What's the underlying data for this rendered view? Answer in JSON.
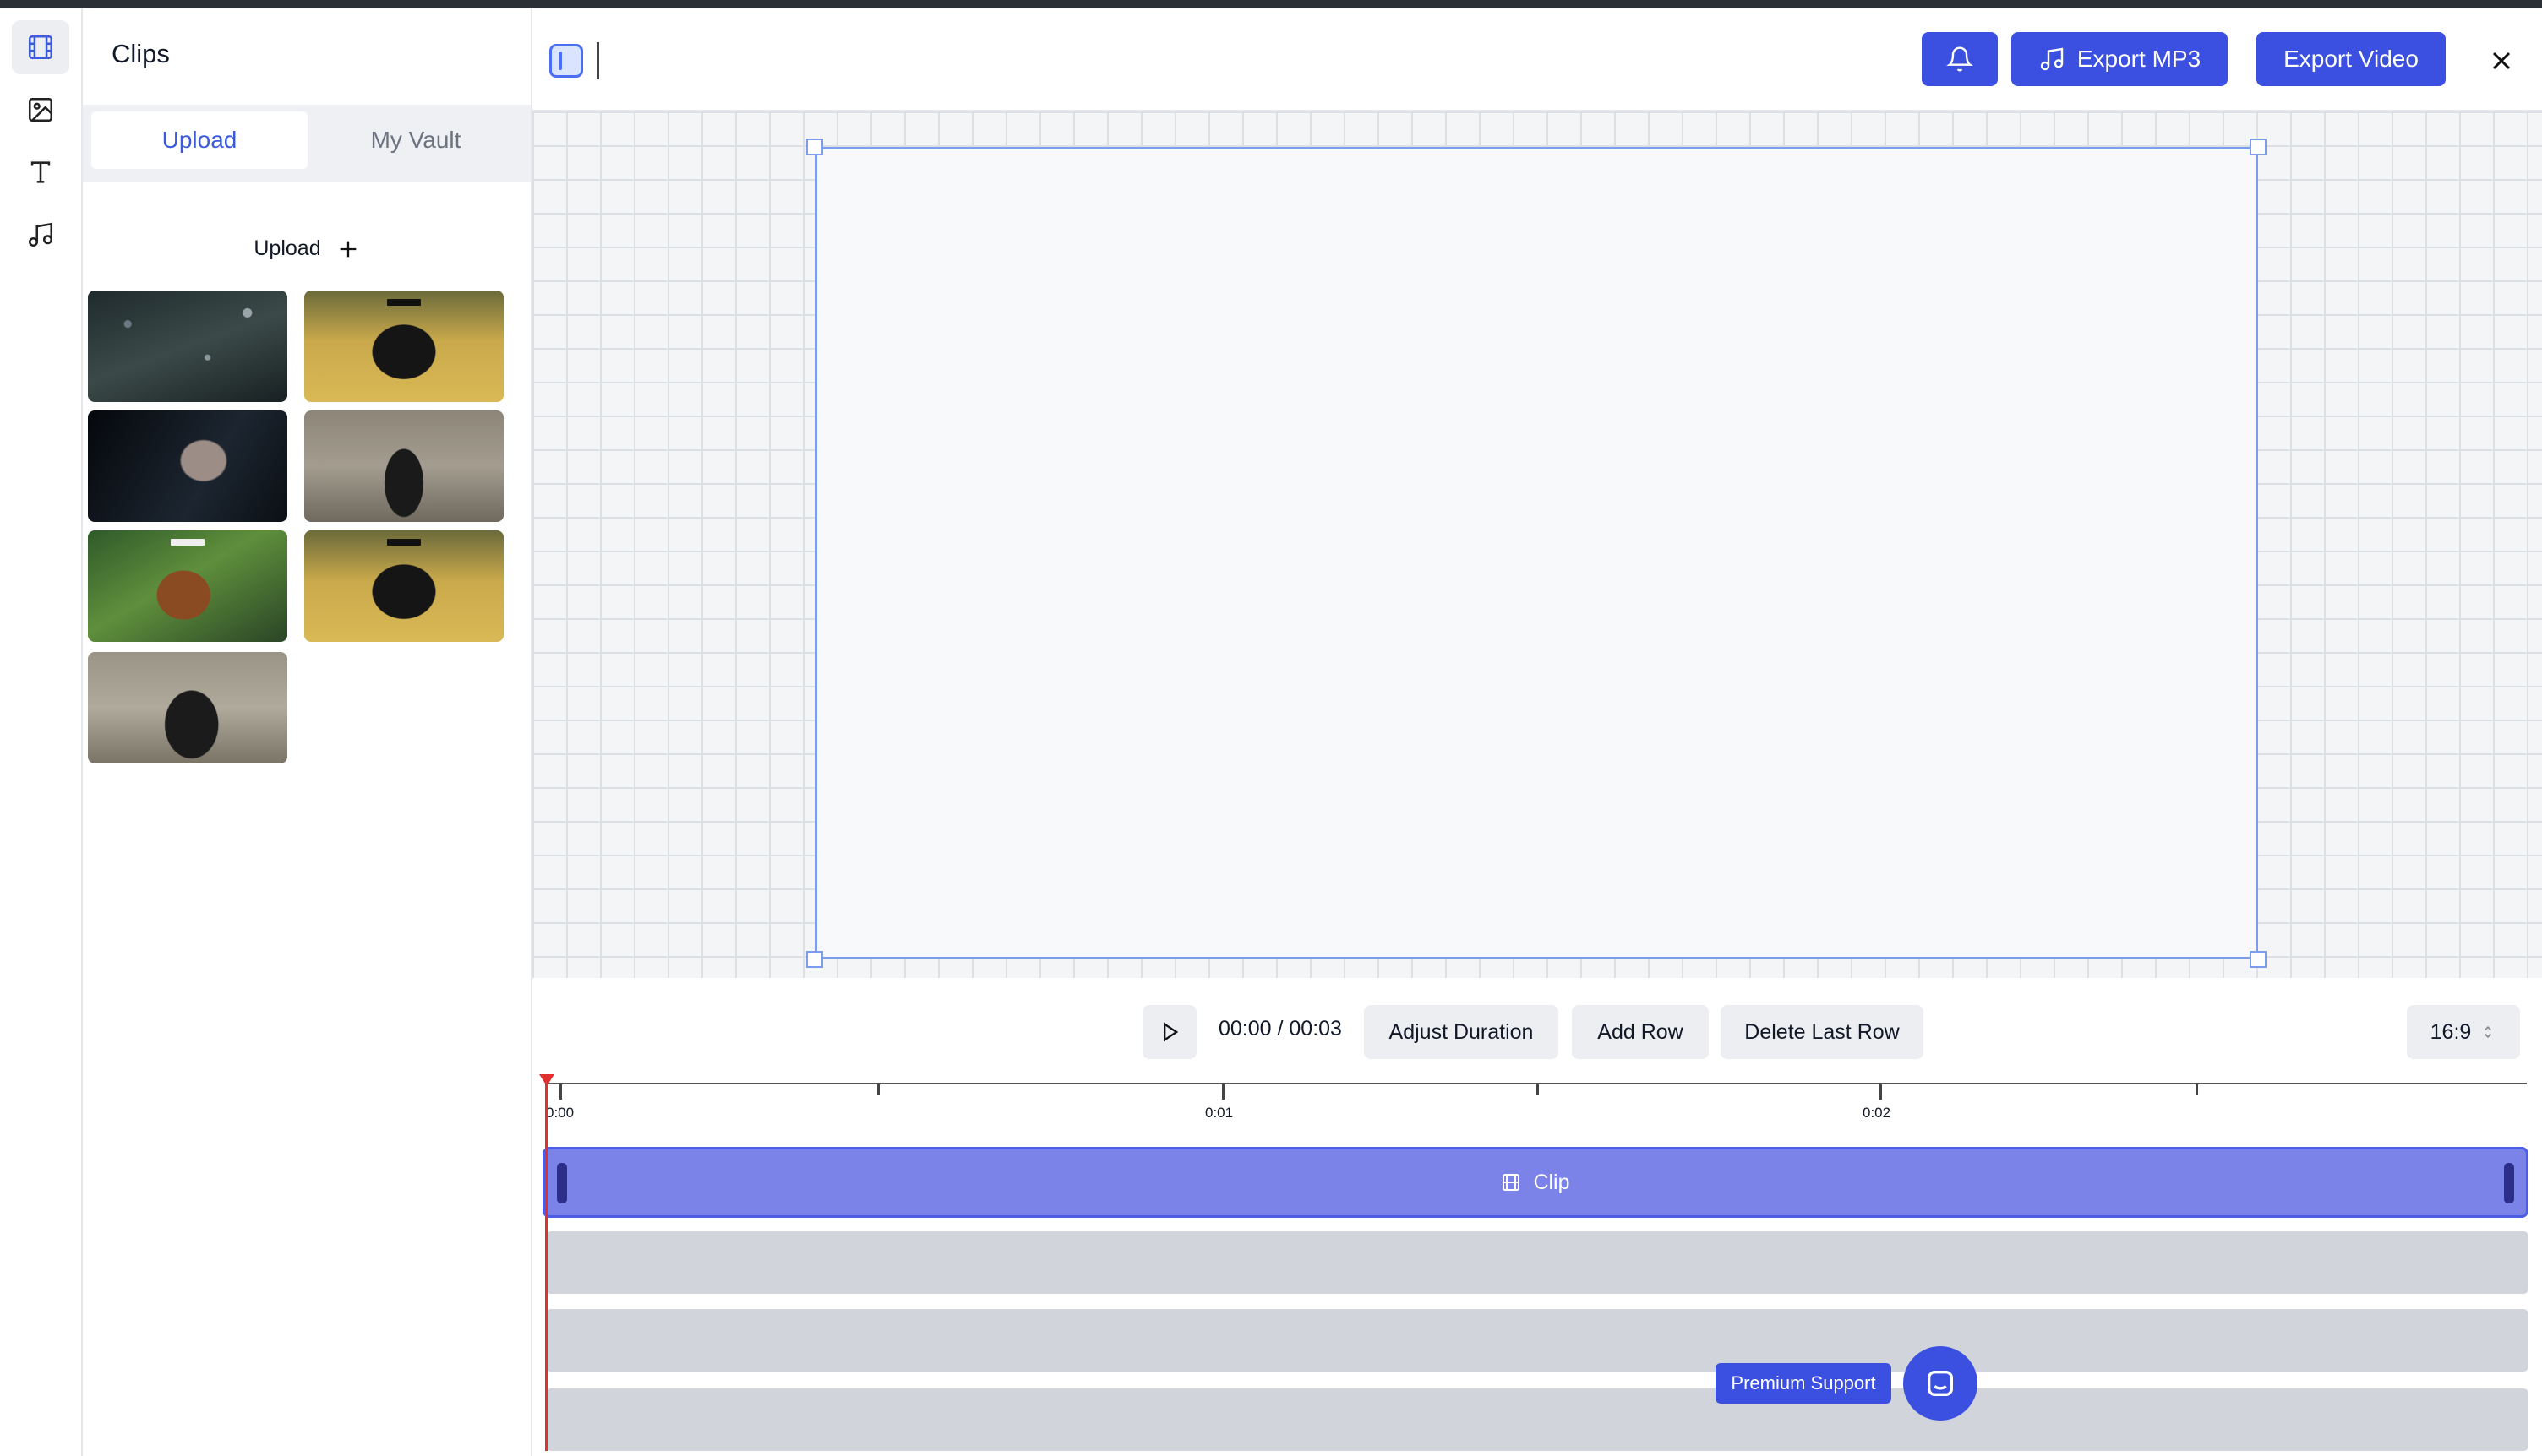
{
  "panel": {
    "title": "Clips",
    "tabs": [
      {
        "label": "Upload",
        "active": true
      },
      {
        "label": "My Vault",
        "active": false
      }
    ],
    "upload_label": "Upload",
    "thumbnails": [
      {
        "name": "rain-glass"
      },
      {
        "name": "dog-field"
      },
      {
        "name": "man-portrait"
      },
      {
        "name": "woman-coat"
      },
      {
        "name": "bear-guitar"
      },
      {
        "name": "dog-field-2"
      },
      {
        "name": "woman-coat-2"
      }
    ]
  },
  "header": {
    "export_mp3": "Export MP3",
    "export_video": "Export Video"
  },
  "controls": {
    "time": "00:00 / 00:03",
    "adjust_duration": "Adjust Duration",
    "add_row": "Add Row",
    "delete_last_row": "Delete Last Row",
    "aspect_ratio": "16:9"
  },
  "timeline": {
    "ticks": [
      "0:00",
      "0:01",
      "0:02"
    ],
    "clip_label": "Clip",
    "empty_rows": 3
  },
  "support": {
    "premium_label": "Premium Support"
  },
  "colors": {
    "accent": "#3b50e0",
    "clip": "#7b82e8",
    "playhead": "#e03131"
  }
}
